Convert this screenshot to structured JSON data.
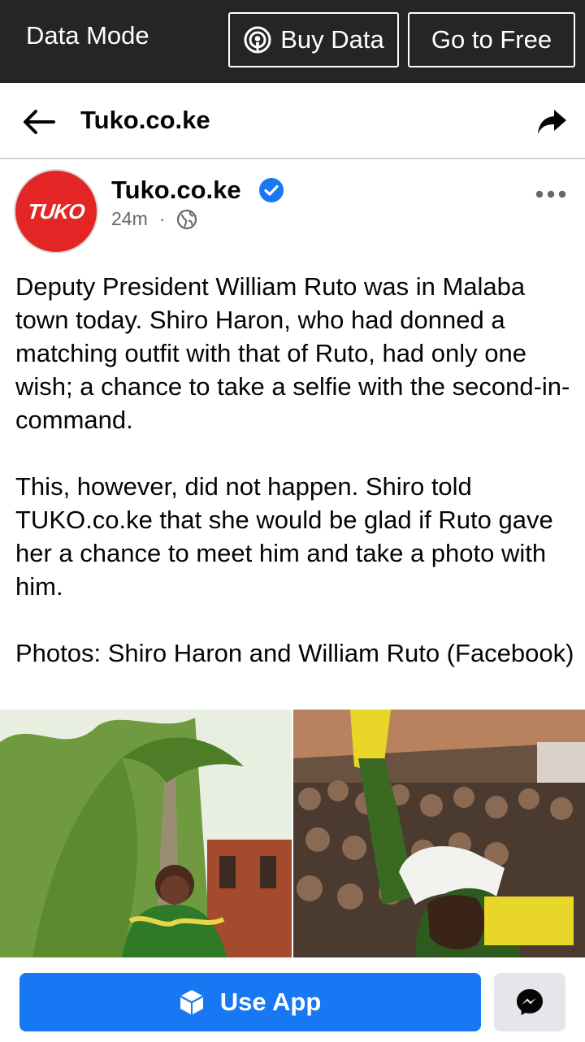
{
  "data_bar": {
    "mode_label": "Data Mode",
    "buy_data_label": "Buy Data",
    "go_free_label": "Go to Free"
  },
  "nav": {
    "title": "Tuko.co.ke"
  },
  "post": {
    "avatar_text": "TUKO",
    "author": "Tuko.co.ke",
    "time": "24m",
    "separator": "·",
    "paragraphs": [
      "Deputy President William Ruto was in Malaba town today. Shiro Haron, who had donned a matching outfit with that of Ruto, had only one wish; a chance to take a selfie with the second-in-command.",
      "This, however, did not happen. Shiro told TUKO.co.ke that she would be glad if Ruto gave her a chance to meet him and take a photo with him.",
      "Photos: Shiro Haron and William Ruto (Facebook)"
    ]
  },
  "bottom": {
    "use_app_label": "Use App"
  },
  "colors": {
    "top_bar": "#242526",
    "brand_blue": "#1877f2",
    "tuko_red": "#e32526",
    "muted_text": "#65676b"
  },
  "icons": [
    "podcast-icon",
    "back-arrow-icon",
    "share-icon",
    "verified-icon",
    "globe-icon",
    "more-icon",
    "cube-icon",
    "messenger-icon"
  ]
}
